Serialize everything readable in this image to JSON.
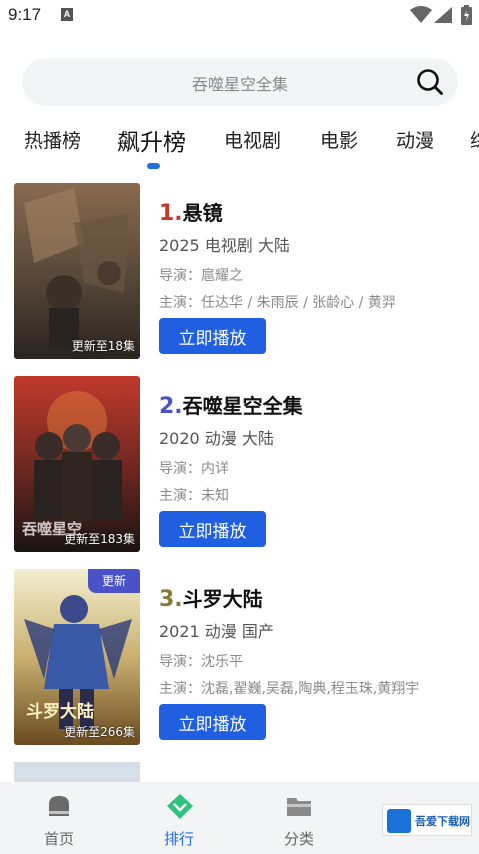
{
  "status": {
    "time": "9:17",
    "notif_letter": "A"
  },
  "search": {
    "placeholder": "吞噬星空全集"
  },
  "tabs": [
    {
      "label": "热播榜"
    },
    {
      "label": "飙升榜",
      "active": true
    },
    {
      "label": "电视剧"
    },
    {
      "label": "电影"
    },
    {
      "label": "动漫"
    },
    {
      "label": "综"
    }
  ],
  "items": [
    {
      "rank": "1.",
      "rank_color": "#c0392b",
      "title": "悬镜",
      "meta": "2025  电视剧  大陆",
      "director": "导演：扈耀之",
      "cast": "主演：任达华 / 朱雨辰 / 张龄心 / 黄羿",
      "episodes": "更新至18集",
      "play_label": "立即播放"
    },
    {
      "rank": "2.",
      "rank_color": "#4a52c8",
      "title": "吞噬星空全集",
      "meta": "2020  动漫  大陆",
      "director": "导演：内详",
      "cast": "主演：未知",
      "episodes": "更新至183集",
      "poster_text": "吞噬星空",
      "play_label": "立即播放"
    },
    {
      "rank": "3.",
      "rank_color": "#8a7a3a",
      "title": "斗罗大陆",
      "meta": "2021  动漫  国产",
      "director": "导演：沈乐平",
      "cast": "主演：沈磊,翟巍,吴磊,陶典,程玉珠,黄翔宇",
      "episodes": "更新至266集",
      "badge": "更新",
      "poster_text": "斗罗大陆",
      "play_label": "立即播放"
    }
  ],
  "nav": [
    {
      "label": "首页",
      "icon": "home-icon"
    },
    {
      "label": "排行",
      "icon": "rank-icon",
      "active": true
    },
    {
      "label": "分类",
      "icon": "folder-icon"
    }
  ],
  "watermark": {
    "text": "吾爱下载网"
  },
  "colors": {
    "accent": "#1f5fe0",
    "active_tab": "#1f6fe0"
  }
}
